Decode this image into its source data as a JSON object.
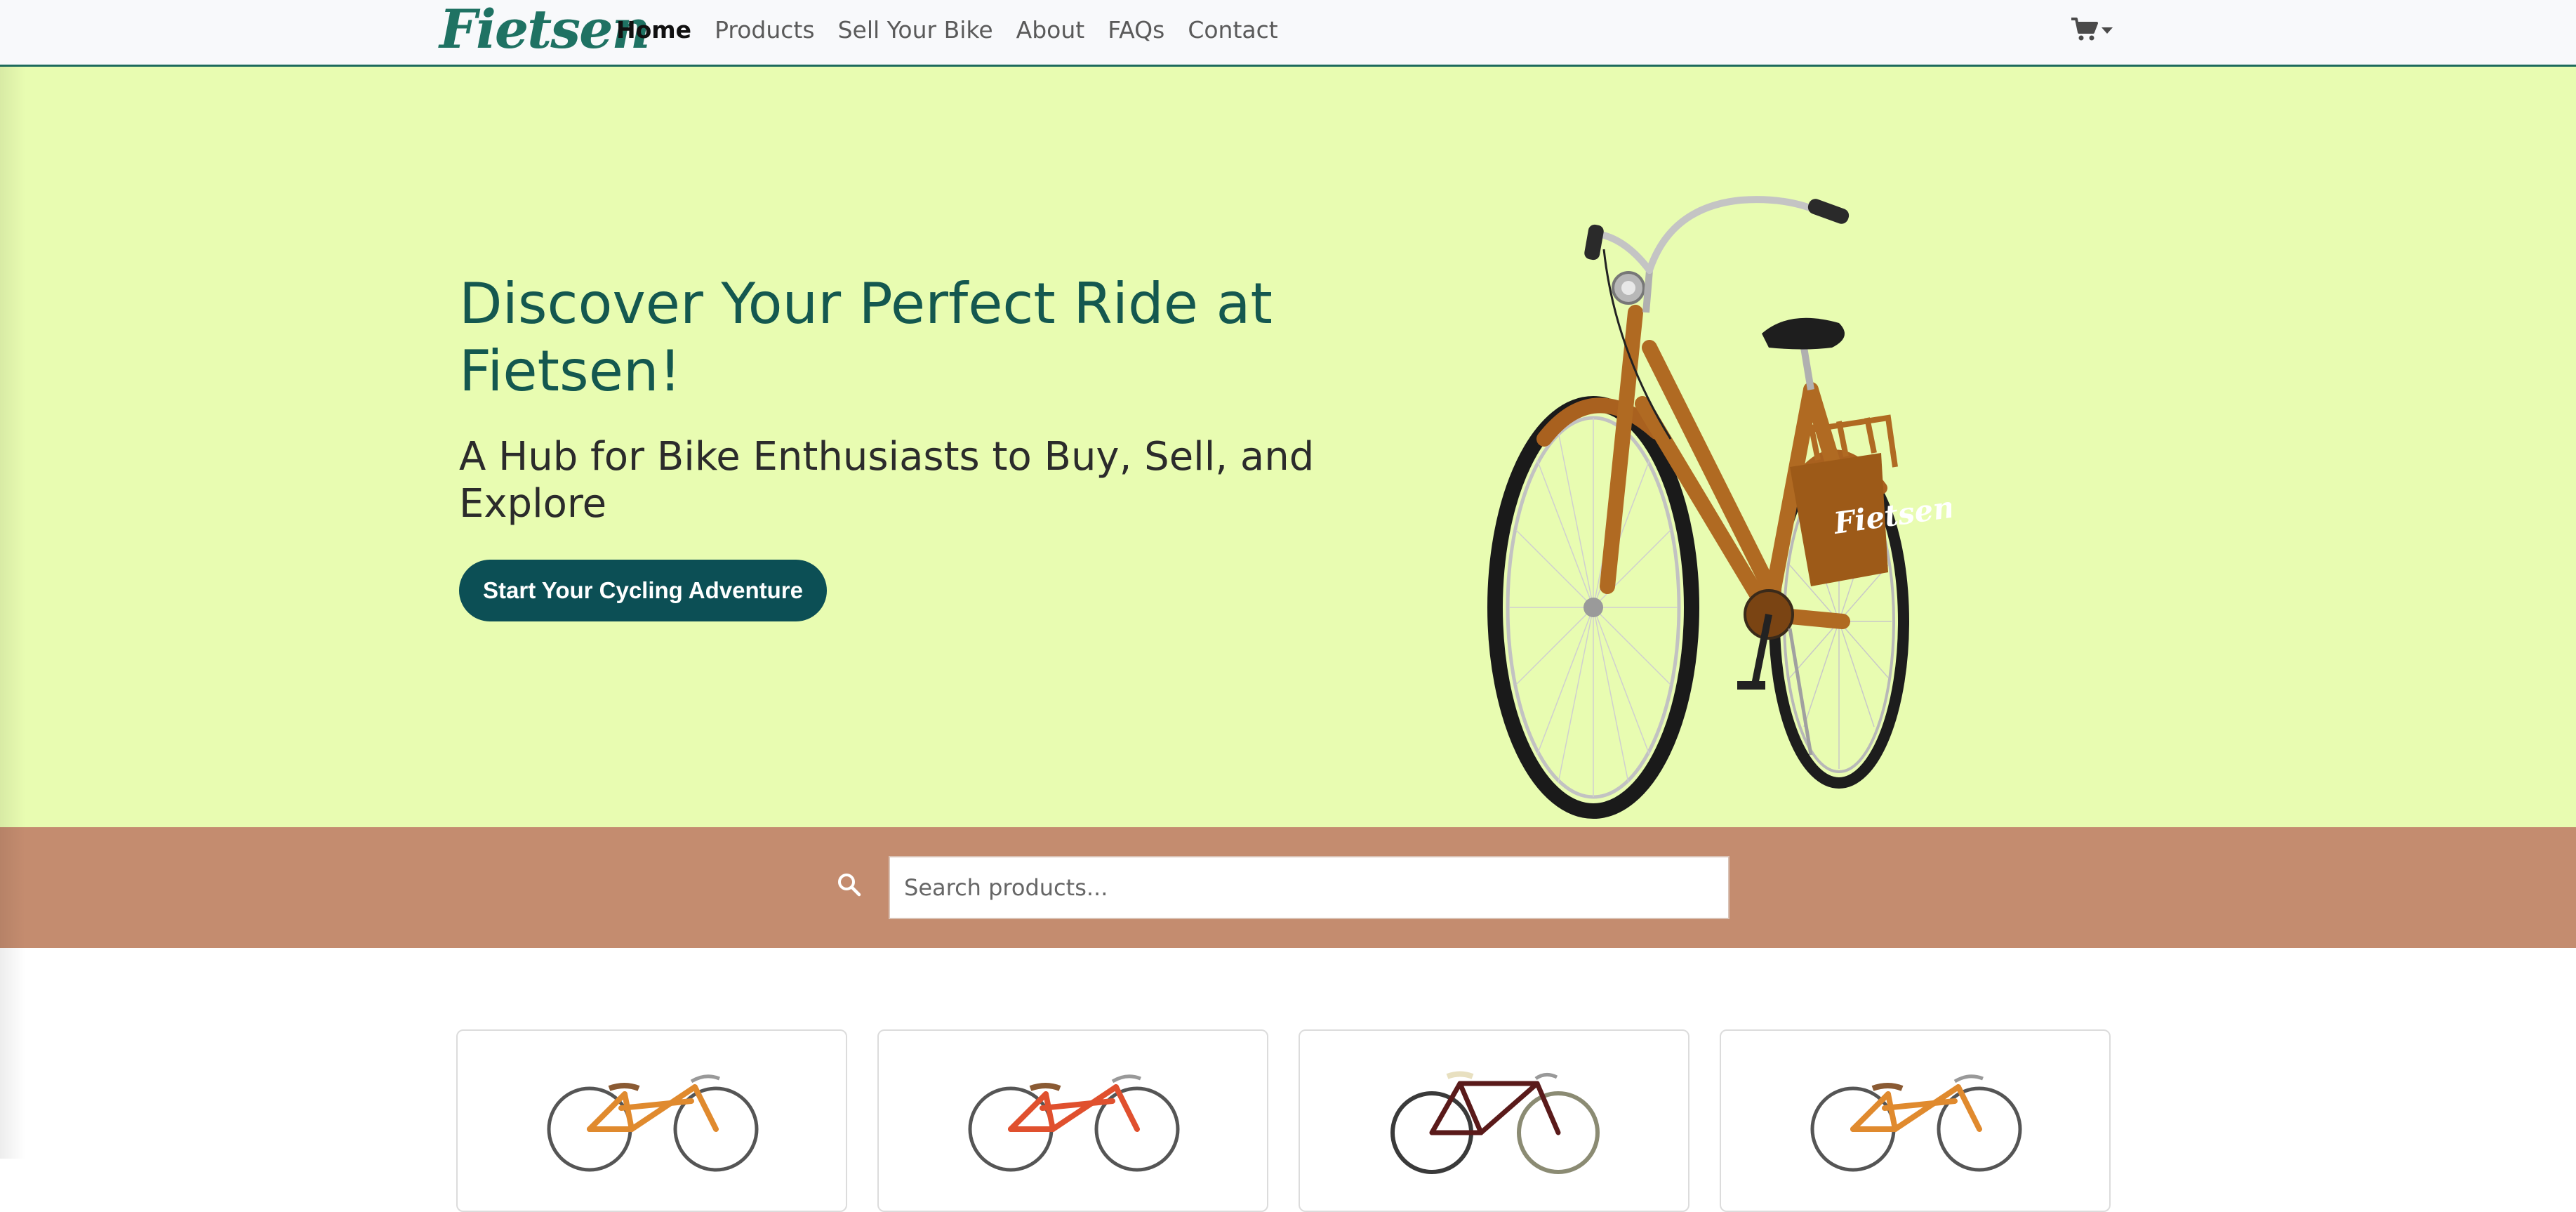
{
  "navbar": {
    "logo_text": "Fietsen",
    "links": [
      {
        "label": "Home",
        "active": true
      },
      {
        "label": "Products",
        "active": false
      },
      {
        "label": "Sell Your Bike",
        "active": false
      },
      {
        "label": "About",
        "active": false
      },
      {
        "label": "FAQs",
        "active": false
      },
      {
        "label": "Contact",
        "active": false
      }
    ],
    "cart_icon": "shopping-cart-icon"
  },
  "hero": {
    "title": "Discover Your Perfect Ride at Fietsen!",
    "subtitle": "A Hub for Bike Enthusiasts to Buy, Sell, and Explore",
    "cta_label": "Start Your Cycling Adventure",
    "bike_badge_text": "Fietsen"
  },
  "search": {
    "placeholder": "Search products...",
    "value": ""
  },
  "products": {
    "cards": [
      {
        "frame_color": "#e08a2e"
      },
      {
        "frame_color": "#e0502e"
      },
      {
        "frame_color": "#5a1a1a"
      },
      {
        "frame_color": "#e08a2e"
      }
    ]
  },
  "colors": {
    "brand": "#1f7263",
    "hero_bg": "#e8fcb1",
    "search_band": "#c48c6f",
    "cta_bg": "#0c4f55"
  }
}
